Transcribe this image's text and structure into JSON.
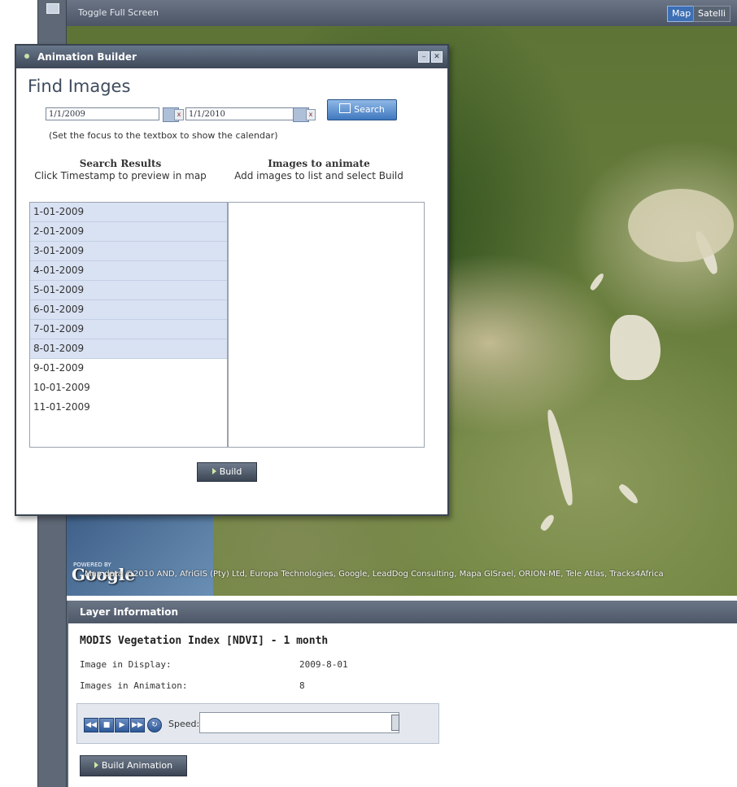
{
  "toolbar": {
    "toggle_label": "Toggle Full Screen",
    "map_button": "Map",
    "satellite_button": "Satelli"
  },
  "map": {
    "attribution": "Map data ©2010 AND, AfriGIS (Pty) Ltd, Europa Technologies, Google, LeadDog Consulting, Mapa GISrael, ORION-ME, Tele Atlas, Tracks4Africa",
    "powered_by": "POWERED BY",
    "logo_text": "Google"
  },
  "builder": {
    "title": "Animation Builder",
    "heading": "Find Images",
    "date_from": "1/1/2009",
    "date_to": "1/1/2010",
    "search_label": "Search",
    "focus_hint": "(Set the focus to the textbox to show the calendar)",
    "results_header": "Search Results",
    "results_sub": "Click Timestamp to preview in map",
    "animate_header": "Images to animate",
    "animate_sub": "Add images to list and select Build",
    "results": [
      {
        "label": "1-01-2009"
      },
      {
        "label": "2-01-2009"
      },
      {
        "label": "3-01-2009"
      },
      {
        "label": "4-01-2009"
      },
      {
        "label": "5-01-2009"
      },
      {
        "label": "6-01-2009"
      },
      {
        "label": "7-01-2009"
      },
      {
        "label": "8-01-2009"
      },
      {
        "label": "9-01-2009"
      },
      {
        "label": "10-01-2009"
      },
      {
        "label": "11-01-2009"
      }
    ],
    "highlighted_count": 8,
    "build_label": "Build"
  },
  "layer": {
    "panel_title": "Layer Information",
    "name": "MODIS Vegetation Index [NDVI] - 1 month",
    "image_display_label": "Image in Display:",
    "image_display_value": "2009-8-01",
    "images_anim_label": "Images in Animation:",
    "images_anim_value": "8",
    "speed_label": "Speed:",
    "speed_level": 0.98,
    "build_animation_label": "Build Animation"
  }
}
